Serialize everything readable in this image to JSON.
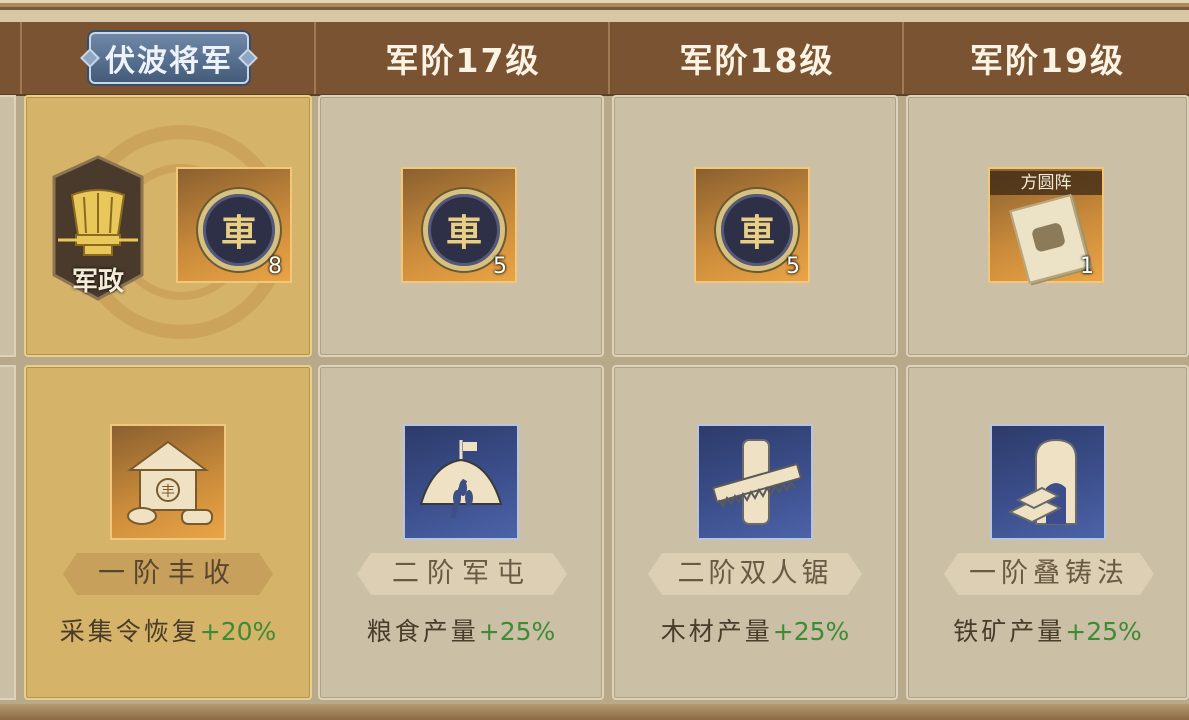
{
  "columns": [
    {
      "title": "伏波将军",
      "current": true
    },
    {
      "title": "军阶17级",
      "current": false
    },
    {
      "title": "军阶18级",
      "current": false
    },
    {
      "title": "军阶19级",
      "current": false
    }
  ],
  "badge": {
    "label": "军政",
    "icon": "hat-icon"
  },
  "rewards": [
    {
      "icon": "army-coin-icon",
      "glyph": "車",
      "count": "8"
    },
    {
      "icon": "army-coin-icon",
      "glyph": "車",
      "count": "5"
    },
    {
      "icon": "army-coin-icon",
      "glyph": "車",
      "count": "5"
    },
    {
      "icon": "formation-book-icon",
      "label": "方圆阵",
      "count": "1"
    }
  ],
  "skills": [
    {
      "name": "一阶丰收",
      "effect": "采集令恢复",
      "bonus": "+20%",
      "icon": "granary-icon"
    },
    {
      "name": "二阶军屯",
      "effect": "粮食产量",
      "bonus": "+25%",
      "icon": "tent-wheat-icon"
    },
    {
      "name": "二阶双人锯",
      "effect": "木材产量",
      "bonus": "+25%",
      "icon": "saw-log-icon"
    },
    {
      "name": "一阶叠铸法",
      "effect": "铁矿产量",
      "bonus": "+25%",
      "icon": "iron-ingot-icon"
    }
  ]
}
